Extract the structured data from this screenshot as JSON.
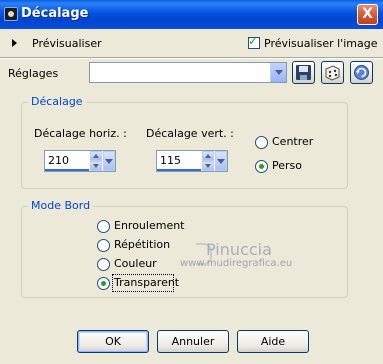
{
  "window": {
    "title": "Décalage",
    "close_glyph": "X"
  },
  "preview": {
    "label": "Prévisualiser",
    "checkbox_label": "Prévisualiser l'image",
    "checked": true
  },
  "settings": {
    "label": "Réglages",
    "value": ""
  },
  "toolbar_icons": [
    "save-icon",
    "random-dice-icon",
    "reset-icon"
  ],
  "offset_group": {
    "title": "Décalage",
    "horizontal_label": "Décalage horiz. :",
    "horizontal_value": "210",
    "vertical_label": "Décalage vert. :",
    "vertical_value": "115",
    "options": [
      {
        "label": "Centrer",
        "selected": false
      },
      {
        "label": "Perso",
        "selected": true
      }
    ]
  },
  "edge_group": {
    "title": "Mode Bord",
    "options": [
      {
        "label": "Enroulement",
        "selected": false
      },
      {
        "label": "Répétition",
        "selected": false
      },
      {
        "label": "Couleur",
        "selected": false
      },
      {
        "label": "Transparent",
        "selected": true
      }
    ]
  },
  "watermark": {
    "name": "Pinuccia",
    "url": "www.mudiregrafica.eu"
  },
  "buttons": {
    "ok": "OK",
    "cancel": "Annuler",
    "help": "Aide"
  },
  "colors": {
    "title_bar": "#0453dc",
    "group_title": "#0046d5",
    "check": "#21a121",
    "background": "#ece9d8"
  }
}
